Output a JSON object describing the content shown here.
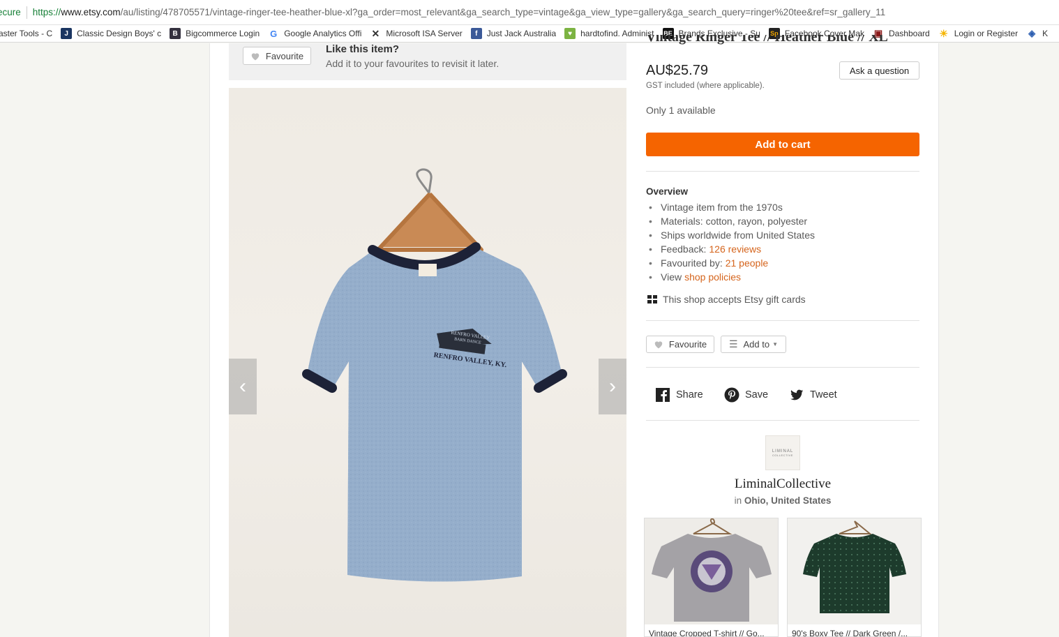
{
  "browser": {
    "secure_label": "ecure",
    "url_scheme": "https://",
    "url_host": "www.etsy.com",
    "url_path": "/au/listing/478705571/vintage-ringer-tee-heather-blue-xl?ga_order=most_relevant&ga_search_type=vintage&ga_view_type=gallery&ga_search_query=ringer%20tee&ref=sr_gallery_11",
    "bookmarks": [
      {
        "label": "aster Tools - C",
        "icon": "generic-icon"
      },
      {
        "label": "Classic Design Boys' c",
        "icon": "j-logo-icon"
      },
      {
        "label": "Bigcommerce Login",
        "icon": "bigcommerce-icon"
      },
      {
        "label": "Google Analytics Offi",
        "icon": "google-icon"
      },
      {
        "label": "Microsoft ISA Server",
        "icon": "isa-server-icon"
      },
      {
        "label": "Just Jack Australia",
        "icon": "facebook-icon"
      },
      {
        "label": "hardtofind. Administ",
        "icon": "hardtofind-icon"
      },
      {
        "label": "Brands Exclusive - Su",
        "icon": "be-icon"
      },
      {
        "label": "Facebook Cover Mak",
        "icon": "sp-icon"
      },
      {
        "label": "Dashboard",
        "icon": "briefcase-icon"
      },
      {
        "label": "Login or Register",
        "icon": "sun-icon"
      },
      {
        "label": "K",
        "icon": "layers-icon"
      }
    ]
  },
  "favourite_banner": {
    "button_label": "Favourite",
    "title": "Like this item?",
    "subtitle": "Add it to your favourites to revisit it later."
  },
  "listing": {
    "title": "Vintage Ringer Tee // Heather Blue // XL",
    "price": "AU$25.79",
    "gst_note": "GST included (where applicable).",
    "ask_label": "Ask a question",
    "availability": "Only 1 available",
    "cart_label": "Add to cart",
    "colors": {
      "accent": "#f56400",
      "link": "#d5641c"
    }
  },
  "photo": {
    "print_line1": "RENFRO VALLEY",
    "print_line2": "BARN DANCE",
    "print_line3": "RENFRO VALLEY, KY."
  },
  "overview": {
    "title": "Overview",
    "items": [
      {
        "text": "Vintage item from the 1970s",
        "link": ""
      },
      {
        "text": "Materials: cotton, rayon, polyester",
        "link": ""
      },
      {
        "text": "Ships worldwide from United States",
        "link": ""
      },
      {
        "text": "Feedback:",
        "link": "126 reviews"
      },
      {
        "text": "Favourited by:",
        "link": "21 people"
      },
      {
        "text": "View",
        "link": "shop policies"
      }
    ],
    "gift_cards": "This shop accepts Etsy gift cards"
  },
  "actions": {
    "favourite": "Favourite",
    "add_to": "Add to"
  },
  "social": {
    "share": "Share",
    "save": "Save",
    "tweet": "Tweet"
  },
  "shop": {
    "logo_text": "LIMINAL",
    "logo_sub": "COLLECTIVE",
    "name": "LiminalCollective",
    "location_prefix": "in",
    "location": "Ohio, United States"
  },
  "related": [
    {
      "caption": "Vintage Cropped T-shirt // Go..."
    },
    {
      "caption": "90's Boxy Tee // Dark Green /..."
    }
  ]
}
